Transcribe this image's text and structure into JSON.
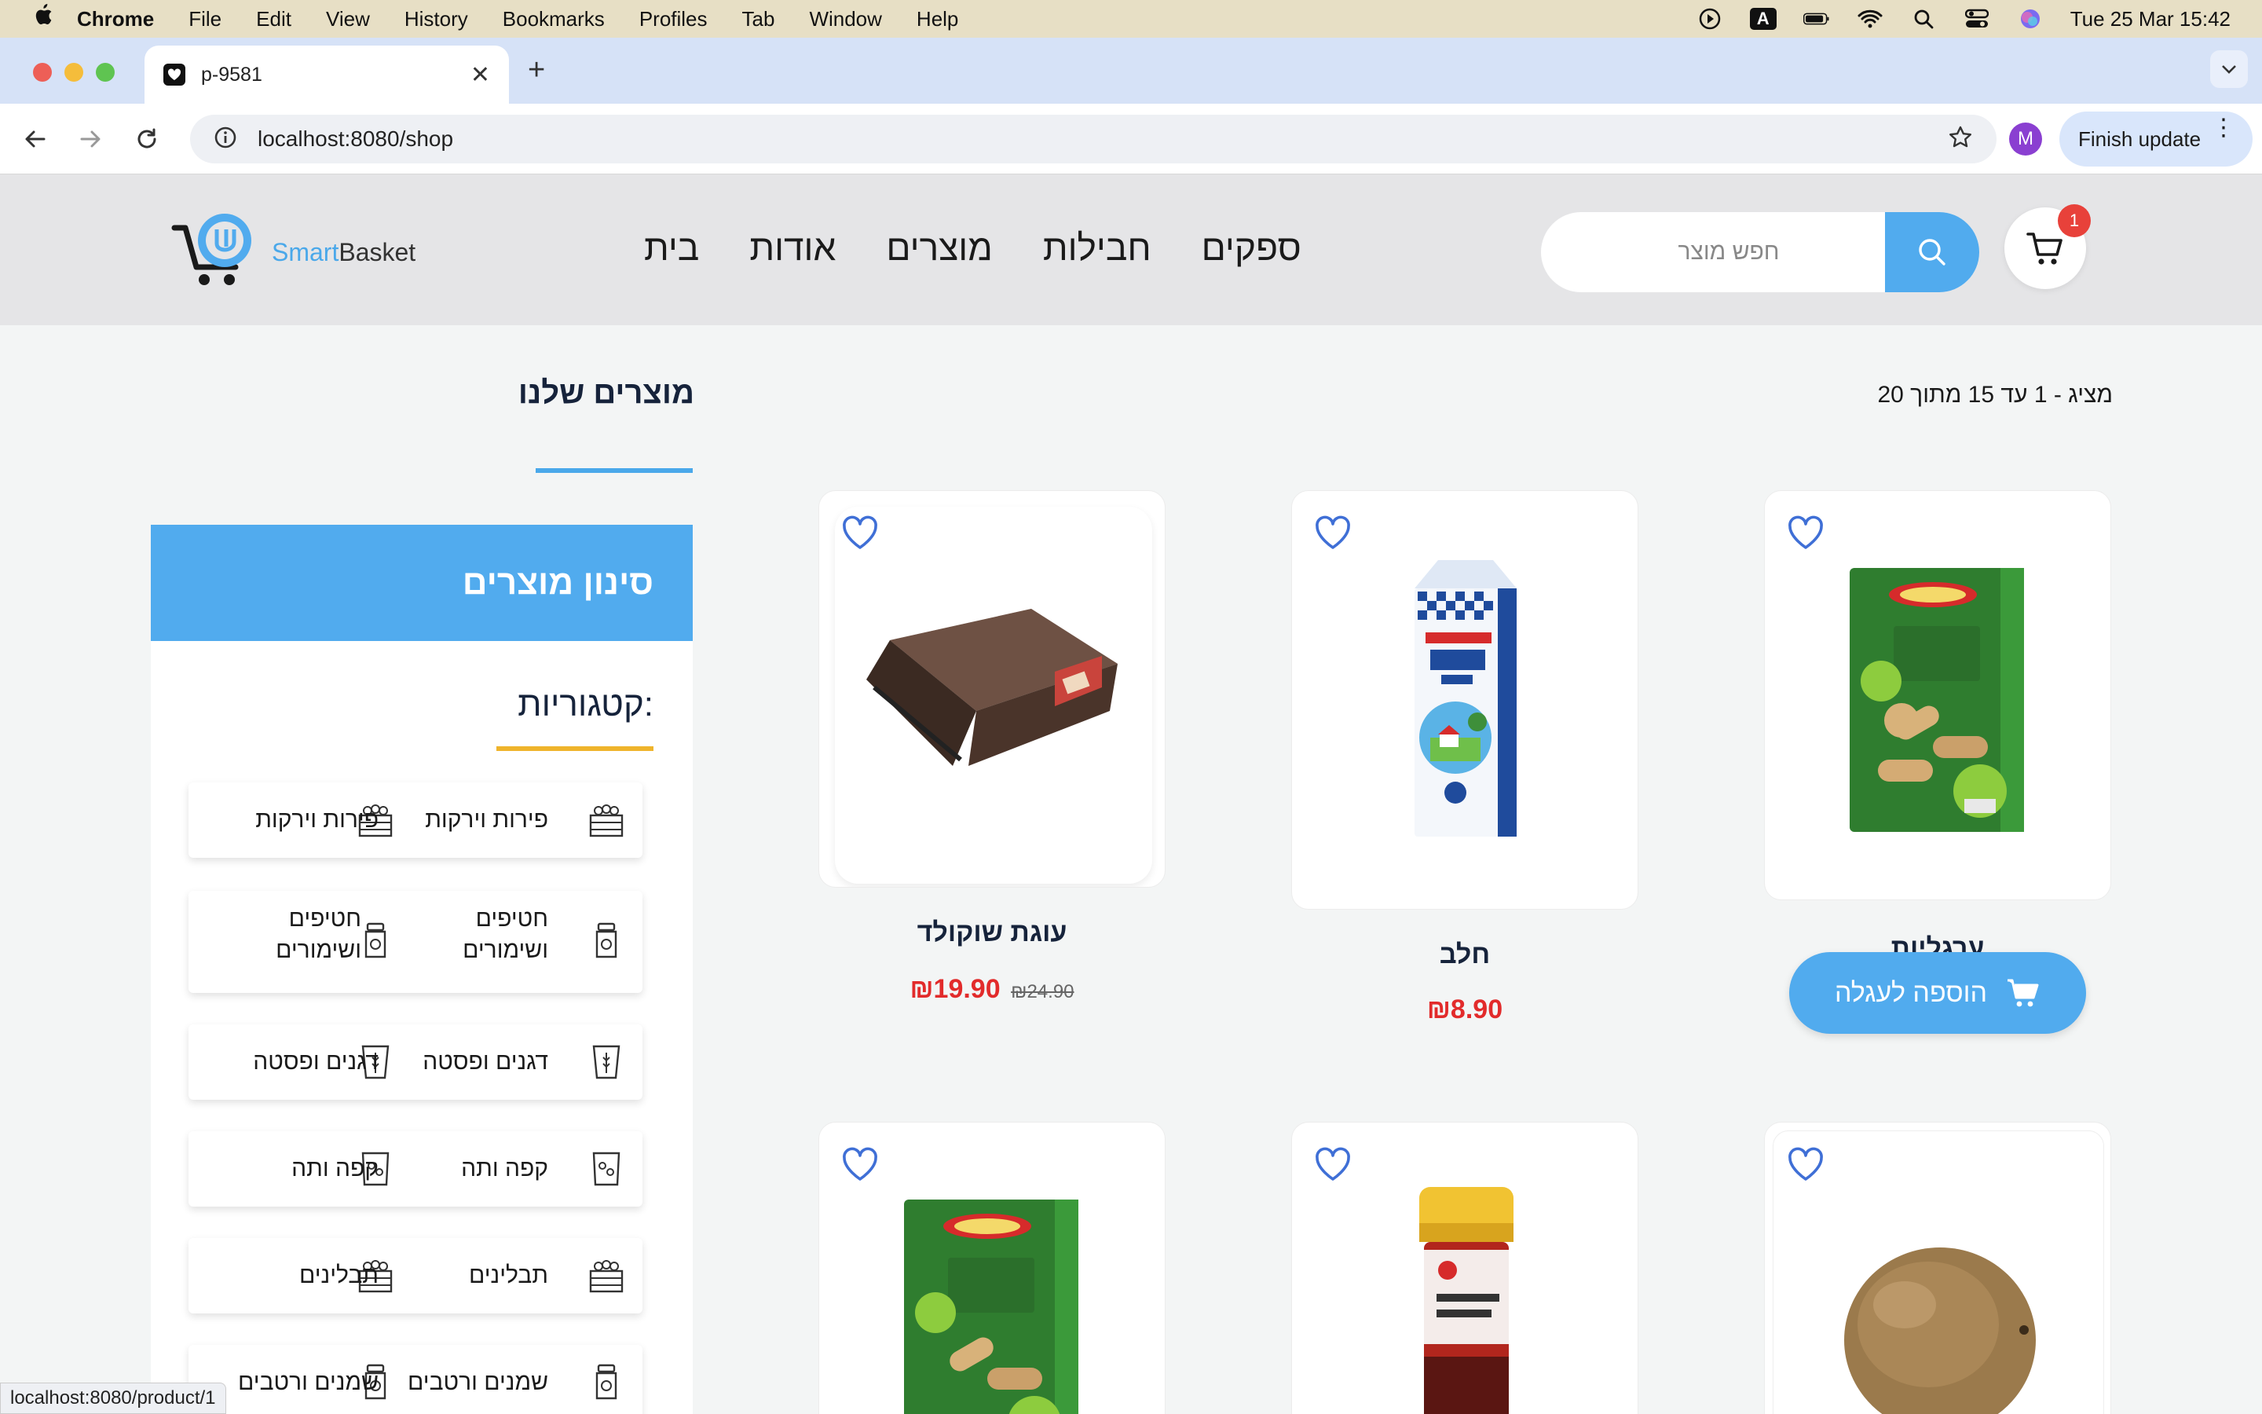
{
  "menubar": {
    "app": "Chrome",
    "items": [
      "File",
      "Edit",
      "View",
      "History",
      "Bookmarks",
      "Profiles",
      "Tab",
      "Window",
      "Help"
    ],
    "datetime": "Tue 25 Mar  15:42",
    "input_indicator": "A"
  },
  "browser": {
    "tab_title": "p-9581",
    "url": "localhost:8080/shop",
    "profile_initial": "M",
    "finish_update": "Finish update",
    "status_url": "localhost:8080/product/1"
  },
  "site": {
    "brand_smart": "Smart",
    "brand_basket": "Basket",
    "nav": [
      "בית",
      "אודות",
      "מוצרים",
      "חבילות",
      "ספקים"
    ],
    "search_placeholder": "חפש מוצר",
    "cart_count": "1",
    "colors": {
      "primary": "#51abee",
      "accent_yellow": "#efb42c",
      "price_red": "#e22b2b",
      "badge_red": "#e8413a"
    }
  },
  "page": {
    "title": "מוצרים שלנו",
    "count_text": "מציג - 1 עד 15 מתוך 20"
  },
  "filter": {
    "header": "סינון מוצרים",
    "categories_title": ":קטגוריות",
    "categories": [
      {
        "label": "פירות וירקות",
        "icon": "produce-crate-icon"
      },
      {
        "label": "חטיפים ושימורים",
        "icon": "jar-icon"
      },
      {
        "label": "דגנים ופסטה",
        "icon": "grain-sack-icon"
      },
      {
        "label": "קפה ותה",
        "icon": "coffee-bag-icon"
      },
      {
        "label": "תבלינים",
        "icon": "spice-crate-icon"
      },
      {
        "label": "שמנים ורטבים",
        "icon": "oil-jar-icon"
      }
    ]
  },
  "products": [
    {
      "name": "ערגליות",
      "price": "",
      "image": "apple-biscuits-box"
    },
    {
      "name": "חלב",
      "price": "₪8.90",
      "image": "milk-carton"
    },
    {
      "name": "עוגת שוקולד",
      "price": "₪19.90",
      "old_price": "₪24.90",
      "image": "chocolate-cake"
    },
    {
      "name": "",
      "price": "",
      "image": "kiwi"
    },
    {
      "name": "",
      "price": "",
      "image": "spice-jar"
    },
    {
      "name": "",
      "price": "",
      "image": "apple-biscuits-box"
    }
  ],
  "add_to_cart_label": "הוספה לעגלה"
}
